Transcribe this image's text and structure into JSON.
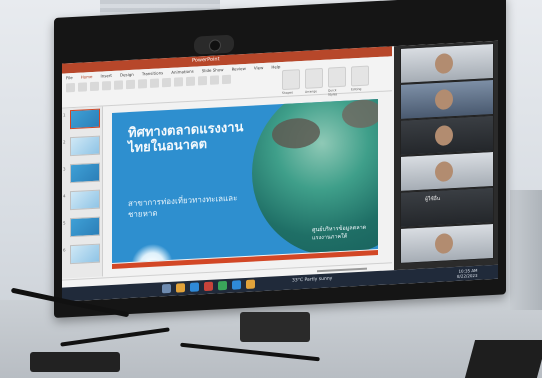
{
  "app": {
    "title": "PowerPoint",
    "accent": "#b7472a"
  },
  "ribbon": {
    "tabs": [
      "File",
      "Home",
      "Insert",
      "Design",
      "Transitions",
      "Animations",
      "Slide Show",
      "Review",
      "View",
      "Help"
    ],
    "active_tab": "Home",
    "big_tools": [
      {
        "label": "Shapes"
      },
      {
        "label": "Arrange"
      },
      {
        "label": "Quick Styles"
      },
      {
        "label": "Editing"
      }
    ]
  },
  "thumbnails": [
    {
      "num": "1",
      "style": "blue"
    },
    {
      "num": "2",
      "style": "light"
    },
    {
      "num": "3",
      "style": "blue"
    },
    {
      "num": "4",
      "style": "light"
    },
    {
      "num": "5",
      "style": "blue"
    },
    {
      "num": "6",
      "style": "light"
    }
  ],
  "slide": {
    "title": "ทิศทางตลาดแรงงานไทยในอนาคต",
    "subtitle": "สาขาการท่องเที่ยวทางทะเลและชายหาด",
    "caption": "ศูนย์บริหารข้อมูลตลาดแรงงานภาคใต้",
    "brand_color": "#2e8fcf"
  },
  "taskbar": {
    "tray_text": "33°C  Partly sunny",
    "time": "10:35 AM",
    "date": "8/22/2023"
  },
  "call_panel": {
    "tiles": [
      {
        "name": "",
        "style": "light"
      },
      {
        "name": "",
        "style": "blue"
      },
      {
        "name": "",
        "style": "dark"
      },
      {
        "name": "",
        "style": "light"
      },
      {
        "name": "",
        "style": "dark"
      },
      {
        "name": "",
        "style": "light"
      }
    ],
    "label": "ผู้ใช้อื่น"
  }
}
